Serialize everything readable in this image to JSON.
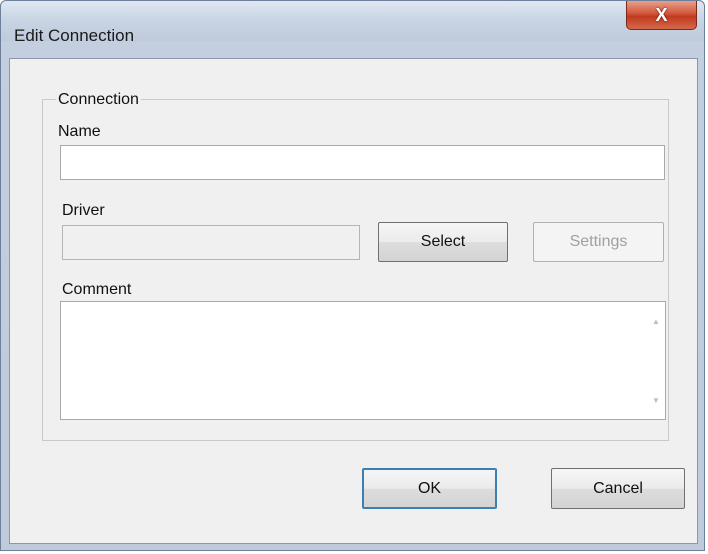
{
  "window": {
    "title": "Edit Connection",
    "close_glyph": "X"
  },
  "group": {
    "legend": "Connection"
  },
  "name_field": {
    "label": "Name",
    "value": ""
  },
  "driver_field": {
    "label": "Driver",
    "value": ""
  },
  "buttons": {
    "select": "Select",
    "settings": "Settings",
    "ok": "OK",
    "cancel": "Cancel"
  },
  "comment_field": {
    "label": "Comment",
    "value": ""
  },
  "icons": {
    "close": "close-icon",
    "scroll_up": "scroll-up-icon",
    "scroll_down": "scroll-down-icon"
  },
  "colors": {
    "close_button": "#c8452a",
    "window_frame": "#c3cfdf",
    "client_bg": "#f0f0f0"
  }
}
